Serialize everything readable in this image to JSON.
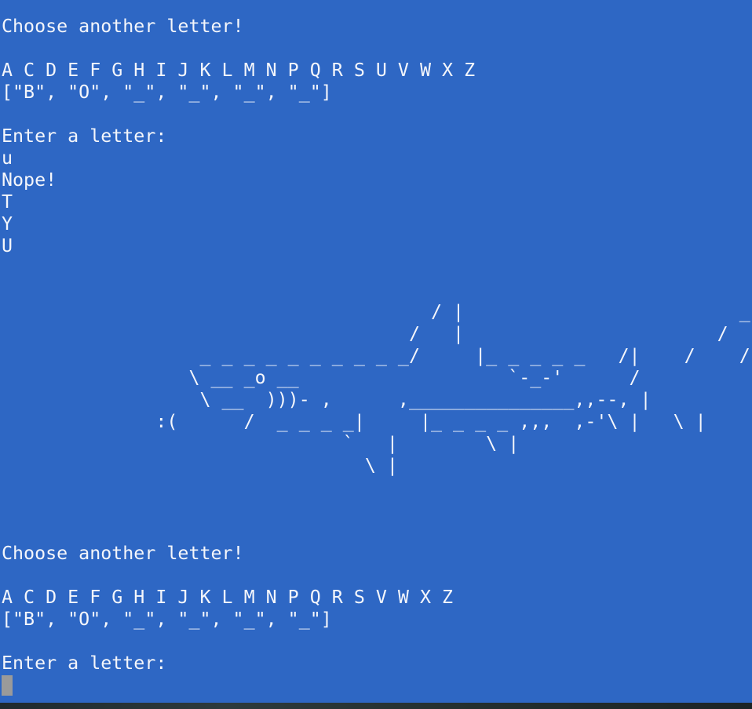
{
  "terminal": {
    "lines": [
      "Choose another letter!",
      "",
      "A C D E F G H I J K L M N P Q R S U V W X Z",
      "[\"B\", \"O\", \"_\", \"_\", \"_\", \"_\"]",
      "",
      "Enter a letter:",
      "u",
      "Nope!",
      "T",
      "Y",
      "U"
    ],
    "ascii_art": "                                       / |                         _,-,\n                                     /   |                       /   /\n                  _ _ _ _ _ _ _ _ _ _/     |_ _ _ _ _   /|    /    /\n                 \\ __ _o __                   `-_-'      /\n                  \\ __  )))- ,      ,_______________,,--, |\n              :(      /  _ _ _ _|     |_ _ _ _ ,,,  ,-'\\ |   \\ |\n                               `   |        \\ |\n                                 \\ |",
    "lines_after": [
      "Choose another letter!",
      "",
      "A C D E F G H I J K L M N P Q R S V W X Z",
      "[\"B\", \"O\", \"_\", \"_\", \"_\", \"_\"]",
      "",
      "Enter a letter:"
    ],
    "background_color": "#2e67c4",
    "text_color": "#f4f6fb",
    "cursor_color": "#9a9a9a"
  }
}
